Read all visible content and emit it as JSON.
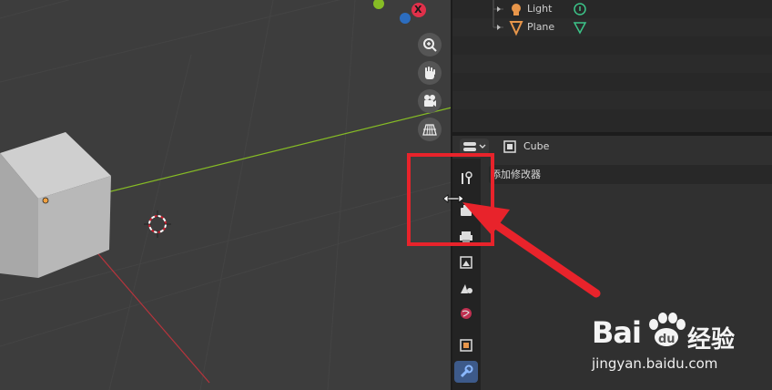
{
  "outliner": {
    "items": [
      {
        "label": "Light",
        "icon": "light-bulb-icon",
        "data_icon": "light-data-icon"
      },
      {
        "label": "Plane",
        "icon": "cone-object-icon",
        "data_icon": "cone-data-icon"
      }
    ]
  },
  "properties": {
    "object_name": "Cube",
    "add_modifier_label": "添加修改器",
    "tabs": [
      "tool-tab-icon",
      "render-tab-icon",
      "output-tab-icon",
      "view-layer-tab-icon",
      "scene-tab-icon",
      "world-tab-icon",
      "object-tab-icon",
      "modifier-tab-icon"
    ],
    "active_tab": "modifier-tab-icon"
  },
  "navigation_gizmo": {
    "axis_x_label": "X",
    "buttons": [
      "zoom-icon",
      "hand-pan-icon",
      "camera-icon",
      "grid-perspective-icon"
    ]
  },
  "colors": {
    "highlight": "#e8232b",
    "axis_x": "#e0304a",
    "axis_y": "#86bc25",
    "axis_z": "#2c6dbf",
    "active_tab": "#3d5a8a"
  },
  "watermark": {
    "brand_left": "Bai",
    "brand_right": "经验",
    "url": "jingyan.baidu.com"
  }
}
